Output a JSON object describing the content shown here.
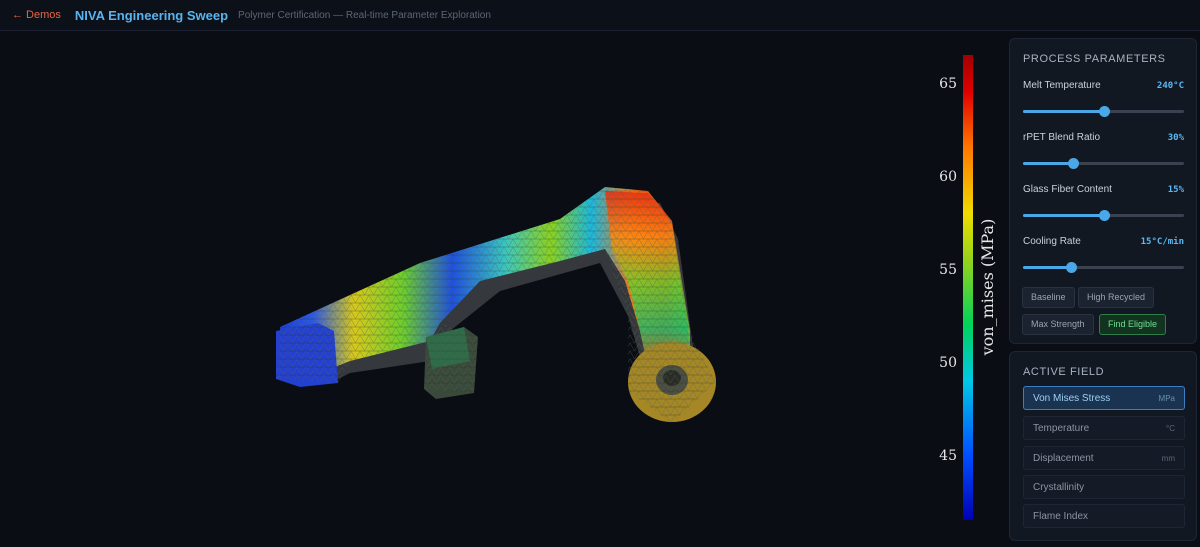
{
  "header": {
    "back_label": "← Demos",
    "title": "NIVA Engineering Sweep",
    "subtitle": "Polymer Certification — Real-time Parameter Exploration"
  },
  "colorbar": {
    "label": "von_mises (MPa)",
    "ticks": [
      "65",
      "60",
      "55",
      "50",
      "45"
    ],
    "tick_values": [
      65,
      60,
      55,
      50,
      45
    ],
    "min": 41.5,
    "max": 66.5,
    "colormap": [
      "#0000b4",
      "#0050ff",
      "#00c8e6",
      "#00d25a",
      "#8cd21e",
      "#f0dc00",
      "#ff7800",
      "#e10000",
      "#a00000"
    ]
  },
  "params": {
    "title": "PROCESS PARAMETERS",
    "items": [
      {
        "label": "Melt Temperature",
        "value": "240°C",
        "fraction": 0.5
      },
      {
        "label": "rPET Blend Ratio",
        "value": "30%",
        "fraction": 0.31
      },
      {
        "label": "Glass Fiber Content",
        "value": "15%",
        "fraction": 0.5
      },
      {
        "label": "Cooling Rate",
        "value": "15°C/min",
        "fraction": 0.3
      }
    ],
    "presets": [
      "Baseline",
      "High Recycled",
      "Max Strength",
      "Find Eligible"
    ]
  },
  "field": {
    "title": "ACTIVE FIELD",
    "items": [
      {
        "name": "Von Mises Stress",
        "unit": "MPa"
      },
      {
        "name": "Temperature",
        "unit": "°C"
      },
      {
        "name": "Displacement",
        "unit": "mm"
      },
      {
        "name": "Crystallinity",
        "unit": ""
      },
      {
        "name": "Flame Index",
        "unit": ""
      }
    ],
    "active_index": 0
  }
}
